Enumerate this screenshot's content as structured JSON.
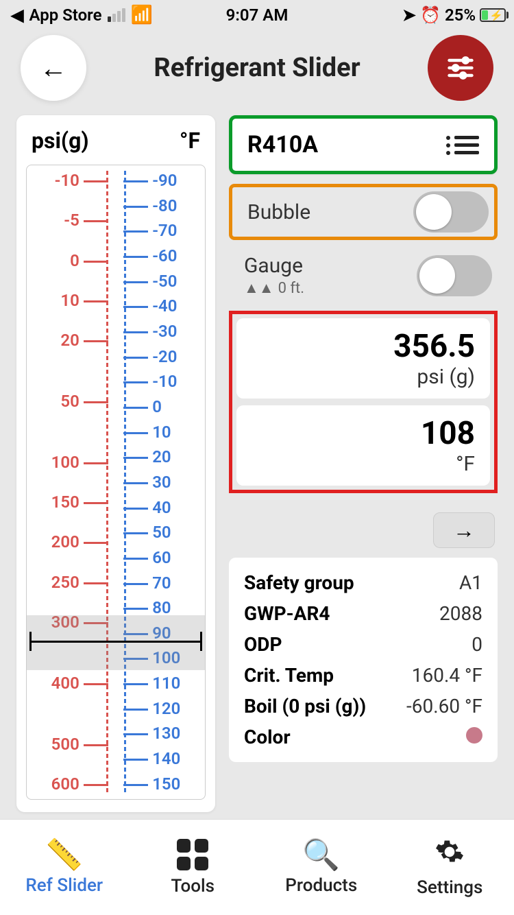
{
  "status": {
    "back_app": "App Store",
    "time": "9:07 AM",
    "battery_pct": "25%"
  },
  "header": {
    "title": "Refrigerant Slider"
  },
  "slider": {
    "pressure_unit": "psi(g)",
    "temp_unit": "°F",
    "psi_ticks": [
      "-10",
      "-5",
      "0",
      "10",
      "20",
      "",
      "50",
      "",
      "100",
      "150",
      "200",
      "250",
      "300",
      "",
      "400",
      "",
      "500",
      "600"
    ],
    "f_ticks": [
      "-90",
      "-80",
      "-70",
      "-60",
      "-50",
      "-40",
      "-30",
      "-20",
      "-10",
      "0",
      "10",
      "20",
      "30",
      "40",
      "50",
      "60",
      "70",
      "80",
      "90",
      "100",
      "110",
      "120",
      "130",
      "140",
      "150"
    ]
  },
  "refrigerant": {
    "name": "R410A"
  },
  "toggles": {
    "bubble_label": "Bubble",
    "gauge_label": "Gauge",
    "gauge_sub": "0 ft."
  },
  "readouts": {
    "pressure_value": "356.5",
    "pressure_unit": "psi (g)",
    "temp_value": "108",
    "temp_unit": "°F"
  },
  "info": {
    "rows": [
      {
        "k": "Safety group",
        "v": "A1"
      },
      {
        "k": "GWP-AR4",
        "v": "2088"
      },
      {
        "k": "ODP",
        "v": "0"
      },
      {
        "k": "Crit. Temp",
        "v": "160.4 °F"
      },
      {
        "k": "Boil (0 psi (g))",
        "v": "-60.60 °F"
      },
      {
        "k": "Color",
        "v": ""
      }
    ],
    "color_hex": "#c77a8a"
  },
  "tabs": [
    {
      "label": "Ref Slider",
      "active": true
    },
    {
      "label": "Tools",
      "active": false
    },
    {
      "label": "Products",
      "active": false
    },
    {
      "label": "Settings",
      "active": false
    }
  ]
}
